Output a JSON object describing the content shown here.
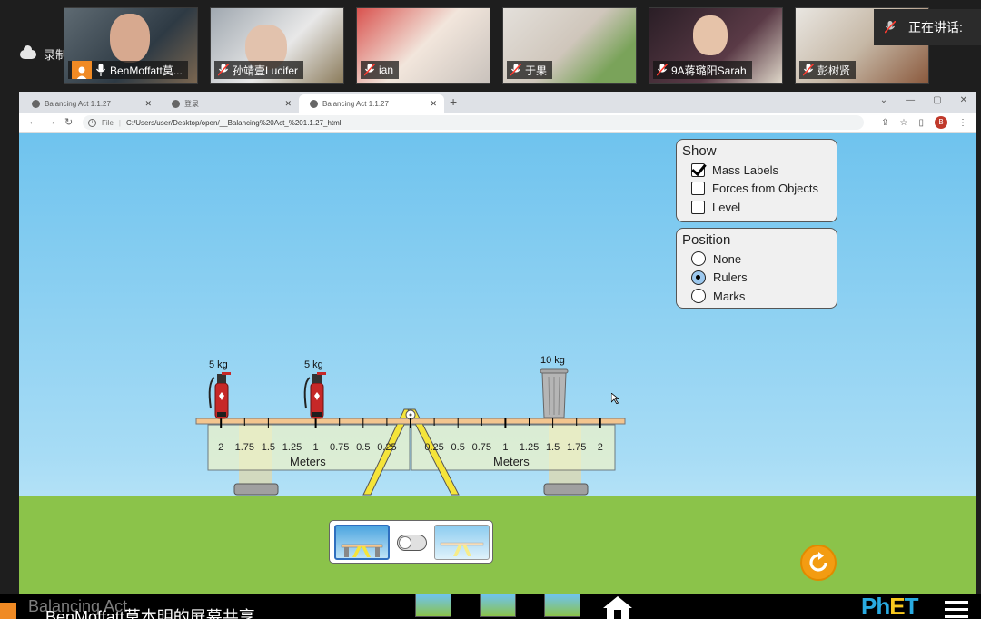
{
  "meeting": {
    "recording_label": "录制中",
    "participants": [
      {
        "name": "BenMoffatt莫..."
      },
      {
        "name": "孙靖壹Lucifer"
      },
      {
        "name": "ian"
      },
      {
        "name": "于果"
      },
      {
        "name": "9A蒋璐阳Sarah"
      },
      {
        "name": "彭树贤"
      }
    ],
    "speaking_label": "正在讲话:",
    "share_banner": "BenMoffatt莫本明的屏幕共享"
  },
  "browser": {
    "tabs": [
      {
        "label": "Balancing Act 1.1.27"
      },
      {
        "label": "登录"
      },
      {
        "label": "Balancing Act 1.1.27"
      }
    ],
    "new_tab": "+",
    "url_scheme": "File",
    "url": "C:/Users/user/Desktop/open/__Balancing%20Act_%201.1.27_html",
    "profile_initial": "B"
  },
  "sim": {
    "title": "Balancing Act",
    "show_panel": {
      "title": "Show",
      "options": [
        {
          "label": "Mass Labels",
          "checked": true
        },
        {
          "label": "Forces from Objects",
          "checked": false
        },
        {
          "label": "Level",
          "checked": false
        }
      ]
    },
    "position_panel": {
      "title": "Position",
      "options": [
        {
          "label": "None",
          "selected": false
        },
        {
          "label": "Rulers",
          "selected": true
        },
        {
          "label": "Marks",
          "selected": false
        }
      ]
    },
    "masses": [
      {
        "label": "5 kg",
        "type": "fire-extinguisher"
      },
      {
        "label": "5 kg",
        "type": "fire-extinguisher"
      },
      {
        "label": "10 kg",
        "type": "trash-can"
      }
    ],
    "ruler": {
      "left_ticks": [
        "2",
        "1.75",
        "1.5",
        "1.25",
        "1",
        "0.75",
        "0.5",
        "0.25"
      ],
      "right_ticks": [
        "0.25",
        "0.5",
        "0.75",
        "1",
        "1.25",
        "1.5",
        "1.75",
        "2"
      ],
      "unit_label": "Meters"
    },
    "colors": {
      "sky": "#6fc3ee",
      "grass": "#8bc34a",
      "plank": "#f3c58f",
      "fulcrum": "#f5e43a",
      "reset": "#f39c12"
    }
  }
}
